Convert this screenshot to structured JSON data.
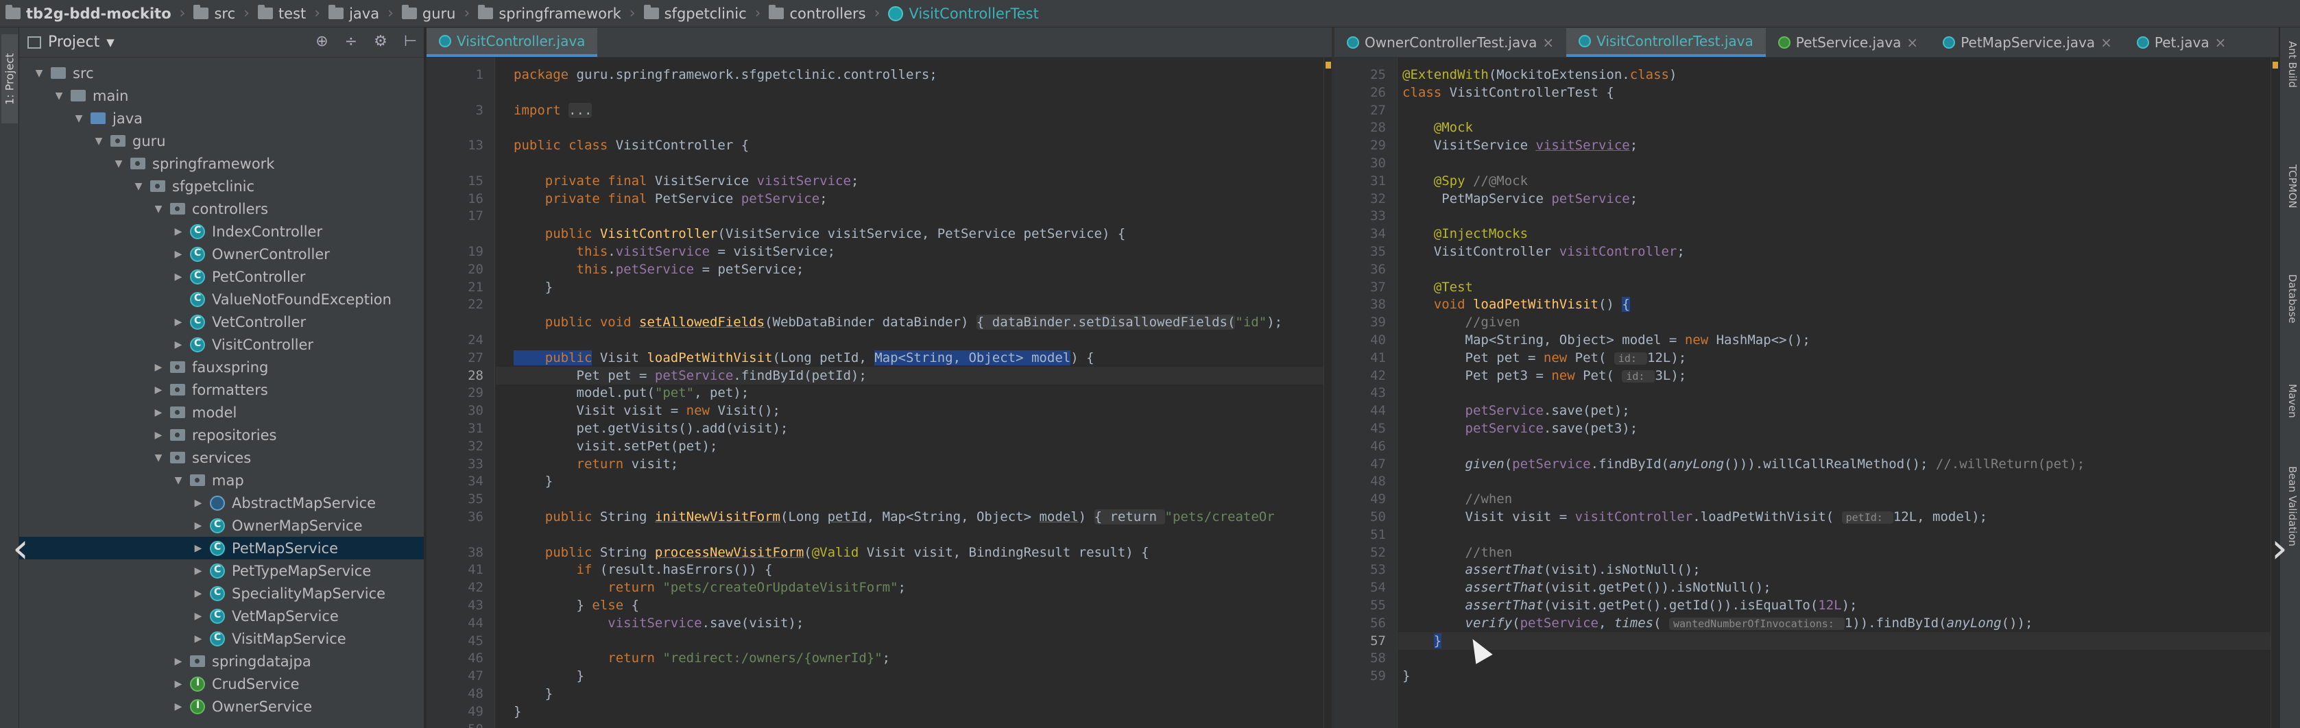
{
  "breadcrumb": [
    "tb2g-bdd-mockito",
    "src",
    "test",
    "java",
    "guru",
    "springframework",
    "sfgpetclinic",
    "controllers",
    "VisitControllerTest"
  ],
  "left_strip_label": "1: Project",
  "project_panel": {
    "title": "Project",
    "tree": [
      {
        "label": "src",
        "depth": 1,
        "icon": "folder",
        "open": true
      },
      {
        "label": "main",
        "depth": 2,
        "icon": "folder",
        "open": true
      },
      {
        "label": "java",
        "depth": 3,
        "icon": "folder-blue",
        "open": true
      },
      {
        "label": "guru",
        "depth": 4,
        "icon": "pkg",
        "open": true
      },
      {
        "label": "springframework",
        "depth": 5,
        "icon": "pkg",
        "open": true
      },
      {
        "label": "sfgpetclinic",
        "depth": 6,
        "icon": "pkg",
        "open": true
      },
      {
        "label": "controllers",
        "depth": 7,
        "icon": "pkg",
        "open": true
      },
      {
        "label": "IndexController",
        "depth": 8,
        "icon": "class",
        "open": false
      },
      {
        "label": "OwnerController",
        "depth": 8,
        "icon": "class",
        "open": false
      },
      {
        "label": "PetController",
        "depth": 8,
        "icon": "class",
        "open": false
      },
      {
        "label": "ValueNotFoundException",
        "depth": 8,
        "icon": "class",
        "open": null
      },
      {
        "label": "VetController",
        "depth": 8,
        "icon": "class",
        "open": false
      },
      {
        "label": "VisitController",
        "depth": 8,
        "icon": "class",
        "open": false
      },
      {
        "label": "fauxspring",
        "depth": 7,
        "icon": "pkg",
        "open": false
      },
      {
        "label": "formatters",
        "depth": 7,
        "icon": "pkg",
        "open": false
      },
      {
        "label": "model",
        "depth": 7,
        "icon": "pkg",
        "open": false
      },
      {
        "label": "repositories",
        "depth": 7,
        "icon": "pkg",
        "open": false
      },
      {
        "label": "services",
        "depth": 7,
        "icon": "pkg",
        "open": true
      },
      {
        "label": "map",
        "depth": 8,
        "icon": "pkg",
        "open": true
      },
      {
        "label": "AbstractMapService",
        "depth": 9,
        "icon": "abstract",
        "open": false
      },
      {
        "label": "OwnerMapService",
        "depth": 9,
        "icon": "class",
        "open": false
      },
      {
        "label": "PetMapService",
        "depth": 9,
        "icon": "class",
        "open": false,
        "selected": true
      },
      {
        "label": "PetTypeMapService",
        "depth": 9,
        "icon": "class",
        "open": false
      },
      {
        "label": "SpecialityMapService",
        "depth": 9,
        "icon": "class",
        "open": false
      },
      {
        "label": "VetMapService",
        "depth": 9,
        "icon": "class",
        "open": false
      },
      {
        "label": "VisitMapService",
        "depth": 9,
        "icon": "class",
        "open": false
      },
      {
        "label": "springdatajpa",
        "depth": 8,
        "icon": "pkg",
        "open": false
      },
      {
        "label": "CrudService",
        "depth": 8,
        "icon": "interface",
        "open": false
      },
      {
        "label": "OwnerService",
        "depth": 8,
        "icon": "interface",
        "open": false
      }
    ]
  },
  "left_editor": {
    "tabs": [
      {
        "label": "VisitController.java",
        "active": true
      }
    ],
    "line_numbers": [
      "1",
      "",
      "3",
      "",
      "13",
      "",
      "15",
      "16",
      "17",
      "",
      "19",
      "20",
      "21",
      "22",
      "",
      "24",
      "27",
      "28",
      "29",
      "30",
      "31",
      "32",
      "33",
      "34",
      "35",
      "36",
      "",
      "38",
      "41",
      "42",
      "43",
      "44",
      "45",
      "46",
      "47",
      "48",
      "49",
      "50"
    ],
    "current_line": "28",
    "lines": [
      [
        {
          "t": "package ",
          "c": "kw"
        },
        {
          "t": "guru.springframework.sfgpetclinic.controllers;"
        }
      ],
      [],
      [
        {
          "t": "import ",
          "c": "kw"
        },
        {
          "t": "...",
          "c": "fold"
        }
      ],
      [],
      [
        {
          "t": "public class ",
          "c": "kw"
        },
        {
          "t": "VisitController {"
        }
      ],
      [],
      [
        {
          "t": "    private final ",
          "c": "kw"
        },
        {
          "t": "VisitService "
        },
        {
          "t": "visitService",
          "c": "fld"
        },
        {
          "t": ";"
        }
      ],
      [
        {
          "t": "    private final ",
          "c": "kw"
        },
        {
          "t": "PetService "
        },
        {
          "t": "petService",
          "c": "fld"
        },
        {
          "t": ";"
        }
      ],
      [],
      [
        {
          "t": "    public ",
          "c": "kw"
        },
        {
          "t": "VisitController",
          "c": "mth"
        },
        {
          "t": "(VisitService visitService, PetService petService) {"
        }
      ],
      [
        {
          "t": "        this",
          "c": "kw"
        },
        {
          "t": "."
        },
        {
          "t": "visitService",
          "c": "fld"
        },
        {
          "t": " = visitService;"
        }
      ],
      [
        {
          "t": "        this",
          "c": "kw"
        },
        {
          "t": "."
        },
        {
          "t": "petService",
          "c": "fld"
        },
        {
          "t": " = petService;"
        }
      ],
      [
        {
          "t": "    }"
        }
      ],
      [],
      [
        {
          "t": "    public void ",
          "c": "kw"
        },
        {
          "t": "setAllowedFields",
          "c": "mth ul"
        },
        {
          "t": "(WebDataBinder dataBinder) "
        },
        {
          "t": "{ dataBinder.setDisallowedFields(",
          "c": "fold"
        },
        {
          "t": "\"id\"",
          "c": "str"
        },
        {
          "t": ");"
        }
      ],
      [],
      [
        {
          "t": "    public",
          "c": "kw hl"
        },
        {
          "t": " Visit "
        },
        {
          "t": "loadPetWithVisit",
          "c": "mth"
        },
        {
          "t": "(Long petId, "
        },
        {
          "t": "Map<String, Object> model",
          "c": "hl"
        },
        {
          "t": ") {"
        }
      ],
      [
        {
          "t": "        Pet pet = "
        },
        {
          "t": "petService",
          "c": "fld"
        },
        {
          "t": ".findById(petId);"
        }
      ],
      [
        {
          "t": "        model.put("
        },
        {
          "t": "\"pet\"",
          "c": "str"
        },
        {
          "t": ", pet);"
        }
      ],
      [
        {
          "t": "        Visit visit = "
        },
        {
          "t": "new ",
          "c": "kw"
        },
        {
          "t": "Visit();"
        }
      ],
      [
        {
          "t": "        pet.getVisits().add(visit);"
        }
      ],
      [
        {
          "t": "        visit.setPet(pet);"
        }
      ],
      [
        {
          "t": "        return ",
          "c": "kw"
        },
        {
          "t": "visit;"
        }
      ],
      [
        {
          "t": "    }"
        }
      ],
      [],
      [
        {
          "t": "    public ",
          "c": "kw"
        },
        {
          "t": "String "
        },
        {
          "t": "initNewVisitForm",
          "c": "mth ul"
        },
        {
          "t": "(Long "
        },
        {
          "t": "petId",
          "c": "ul"
        },
        {
          "t": ", Map<String, Object> "
        },
        {
          "t": "model",
          "c": "ul"
        },
        {
          "t": ") "
        },
        {
          "t": "{ return ",
          "c": "fold"
        },
        {
          "t": "\"pets/createOr",
          "c": "str"
        }
      ],
      [],
      [
        {
          "t": "    public ",
          "c": "kw"
        },
        {
          "t": "String "
        },
        {
          "t": "processNewVisitForm",
          "c": "mth ul"
        },
        {
          "t": "("
        },
        {
          "t": "@Valid",
          "c": "ann"
        },
        {
          "t": " Visit visit, BindingResult result) {"
        }
      ],
      [
        {
          "t": "        if ",
          "c": "kw"
        },
        {
          "t": "(result.hasErrors()) {"
        }
      ],
      [
        {
          "t": "            return ",
          "c": "kw"
        },
        {
          "t": "\"pets/createOrUpdateVisitForm\"",
          "c": "str"
        },
        {
          "t": ";"
        }
      ],
      [
        {
          "t": "        } "
        },
        {
          "t": "else ",
          "c": "kw"
        },
        {
          "t": "{"
        }
      ],
      [
        {
          "t": "            "
        },
        {
          "t": "visitService",
          "c": "fld"
        },
        {
          "t": ".save(visit);"
        }
      ],
      [],
      [
        {
          "t": "            return ",
          "c": "kw"
        },
        {
          "t": "\"redirect:/owners/{ownerId}\"",
          "c": "str"
        },
        {
          "t": ";"
        }
      ],
      [
        {
          "t": "        }"
        }
      ],
      [
        {
          "t": "    }"
        }
      ],
      [
        {
          "t": "}"
        }
      ]
    ]
  },
  "right_editor": {
    "tabs": [
      {
        "label": "OwnerControllerTest.java",
        "active": false,
        "icon": "class"
      },
      {
        "label": "VisitControllerTest.java",
        "active": true,
        "icon": "class"
      },
      {
        "label": "PetService.java",
        "active": false,
        "icon": "interface"
      },
      {
        "label": "PetMapService.java",
        "active": false,
        "icon": "class"
      },
      {
        "label": "Pet.java",
        "active": false,
        "icon": "class"
      }
    ],
    "line_numbers": [
      "25",
      "26",
      "27",
      "28",
      "29",
      "30",
      "31",
      "32",
      "33",
      "34",
      "35",
      "36",
      "37",
      "38",
      "39",
      "40",
      "41",
      "42",
      "43",
      "44",
      "45",
      "46",
      "47",
      "48",
      "49",
      "50",
      "51",
      "52",
      "53",
      "54",
      "55",
      "56",
      "57",
      "58",
      "59"
    ],
    "current_line": "57",
    "lines": [
      [
        {
          "t": "@ExtendWith",
          "c": "ann"
        },
        {
          "t": "(MockitoExtension."
        },
        {
          "t": "class",
          "c": "kw"
        },
        {
          "t": ")"
        }
      ],
      [
        {
          "t": "class ",
          "c": "kw"
        },
        {
          "t": "VisitControllerTest {"
        }
      ],
      [],
      [
        {
          "t": "    "
        },
        {
          "t": "@Mock",
          "c": "ann"
        }
      ],
      [
        {
          "t": "    VisitService "
        },
        {
          "t": "visitService",
          "c": "fld ul"
        },
        {
          "t": ";"
        }
      ],
      [],
      [
        {
          "t": "    "
        },
        {
          "t": "@Spy",
          "c": "ann"
        },
        {
          "t": " //@Mock",
          "c": "cmt"
        }
      ],
      [
        {
          "t": "     PetMapService "
        },
        {
          "t": "petService",
          "c": "fld"
        },
        {
          "t": ";"
        }
      ],
      [],
      [
        {
          "t": "    "
        },
        {
          "t": "@InjectMocks",
          "c": "ann"
        }
      ],
      [
        {
          "t": "    VisitController "
        },
        {
          "t": "visitController",
          "c": "fld"
        },
        {
          "t": ";"
        }
      ],
      [],
      [
        {
          "t": "    "
        },
        {
          "t": "@Test",
          "c": "ann"
        }
      ],
      [
        {
          "t": "    void ",
          "c": "kw"
        },
        {
          "t": "loadPetWithVisit",
          "c": "mth"
        },
        {
          "t": "() "
        },
        {
          "t": "{",
          "c": "hl"
        }
      ],
      [
        {
          "t": "        //given",
          "c": "cmt"
        }
      ],
      [
        {
          "t": "        Map<String, Object> model = "
        },
        {
          "t": "new ",
          "c": "kw"
        },
        {
          "t": "HashMap<>();"
        }
      ],
      [
        {
          "t": "        Pet pet = "
        },
        {
          "t": "new ",
          "c": "kw"
        },
        {
          "t": "Pet( "
        },
        {
          "t": "id: ",
          "c": "hint"
        },
        {
          "t": "12L);"
        }
      ],
      [
        {
          "t": "        Pet pet3 = "
        },
        {
          "t": "new ",
          "c": "kw"
        },
        {
          "t": "Pet( "
        },
        {
          "t": "id: ",
          "c": "hint"
        },
        {
          "t": "3L);"
        }
      ],
      [],
      [
        {
          "t": "        "
        },
        {
          "t": "petService",
          "c": "fld"
        },
        {
          "t": ".save(pet);"
        }
      ],
      [
        {
          "t": "        "
        },
        {
          "t": "petService",
          "c": "fld"
        },
        {
          "t": ".save(pet3);"
        }
      ],
      [],
      [
        {
          "t": "        "
        },
        {
          "t": "given",
          "c": "it"
        },
        {
          "t": "("
        },
        {
          "t": "petService",
          "c": "fld"
        },
        {
          "t": ".findById("
        },
        {
          "t": "anyLong",
          "c": "it"
        },
        {
          "t": "())).willCallRealMethod(); "
        },
        {
          "t": "//.willReturn(pet);",
          "c": "cmt"
        }
      ],
      [],
      [
        {
          "t": "        //when",
          "c": "cmt"
        }
      ],
      [
        {
          "t": "        Visit visit = "
        },
        {
          "t": "visitController",
          "c": "fld"
        },
        {
          "t": ".loadPetWithVisit( "
        },
        {
          "t": "petId: ",
          "c": "hint"
        },
        {
          "t": "12L, model);"
        }
      ],
      [],
      [
        {
          "t": "        //then",
          "c": "cmt"
        }
      ],
      [
        {
          "t": "        "
        },
        {
          "t": "assertThat",
          "c": "it"
        },
        {
          "t": "(visit).isNotNull();"
        }
      ],
      [
        {
          "t": "        "
        },
        {
          "t": "assertThat",
          "c": "it"
        },
        {
          "t": "(visit.getPet()).isNotNull();"
        }
      ],
      [
        {
          "t": "        "
        },
        {
          "t": "assertThat",
          "c": "it"
        },
        {
          "t": "(visit.getPet().getId()).isEqualTo("
        },
        {
          "t": "12L",
          "c": "fld"
        },
        {
          "t": ");"
        }
      ],
      [
        {
          "t": "        "
        },
        {
          "t": "verify",
          "c": "it"
        },
        {
          "t": "("
        },
        {
          "t": "petService",
          "c": "fld"
        },
        {
          "t": ", "
        },
        {
          "t": "times",
          "c": "it"
        },
        {
          "t": "( "
        },
        {
          "t": "wantedNumberOfInvocations: ",
          "c": "hint"
        },
        {
          "t": "1)).findById("
        },
        {
          "t": "anyLong",
          "c": "it"
        },
        {
          "t": "());"
        }
      ],
      [
        {
          "t": "    "
        },
        {
          "t": "}",
          "c": "hl"
        }
      ],
      [],
      [
        {
          "t": "}"
        }
      ]
    ]
  },
  "right_strip": [
    "Ant Build",
    "TCPMON",
    "Database",
    "Maven",
    "Bean Validation"
  ],
  "colors": {
    "keyword": "#cc7832",
    "string": "#6a8759",
    "annotation": "#bbb529",
    "field": "#9876aa",
    "method": "#ffc66d",
    "comment": "#808080",
    "selection": "#0d293e"
  }
}
